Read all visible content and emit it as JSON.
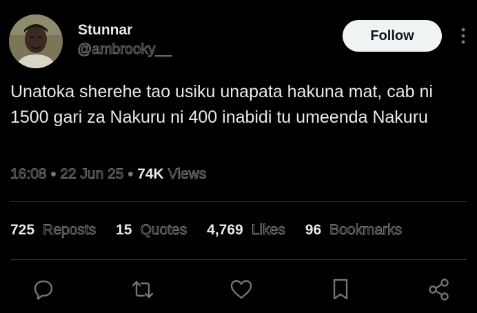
{
  "author": {
    "display_name": "Stunnar",
    "handle": "@ambrooky__"
  },
  "follow_label": "Follow",
  "tweet": {
    "text": "Unatoka sherehe tao usiku unapata hakuna mat, cab ni 1500 gari za Nakuru ni 400 inabidi tu umeenda Nakuru",
    "time": "16:08",
    "date": "22 Jun 25",
    "views_count": "74K",
    "views_label": "Views"
  },
  "stats": [
    {
      "count": "725",
      "label": "Reposts"
    },
    {
      "count": "15",
      "label": "Quotes"
    },
    {
      "count": "4,769",
      "label": "Likes"
    },
    {
      "count": "96",
      "label": "Bookmarks"
    }
  ],
  "actions": [
    "reply-icon",
    "repost-icon",
    "like-icon",
    "bookmark-icon",
    "share-icon"
  ],
  "colors": {
    "background": "#000000",
    "primary_text": "#e7e9ea",
    "secondary_text": "#71767b",
    "divider": "#2f3336",
    "follow_button_bg": "#eff3f4",
    "follow_button_text": "#0f1419"
  }
}
